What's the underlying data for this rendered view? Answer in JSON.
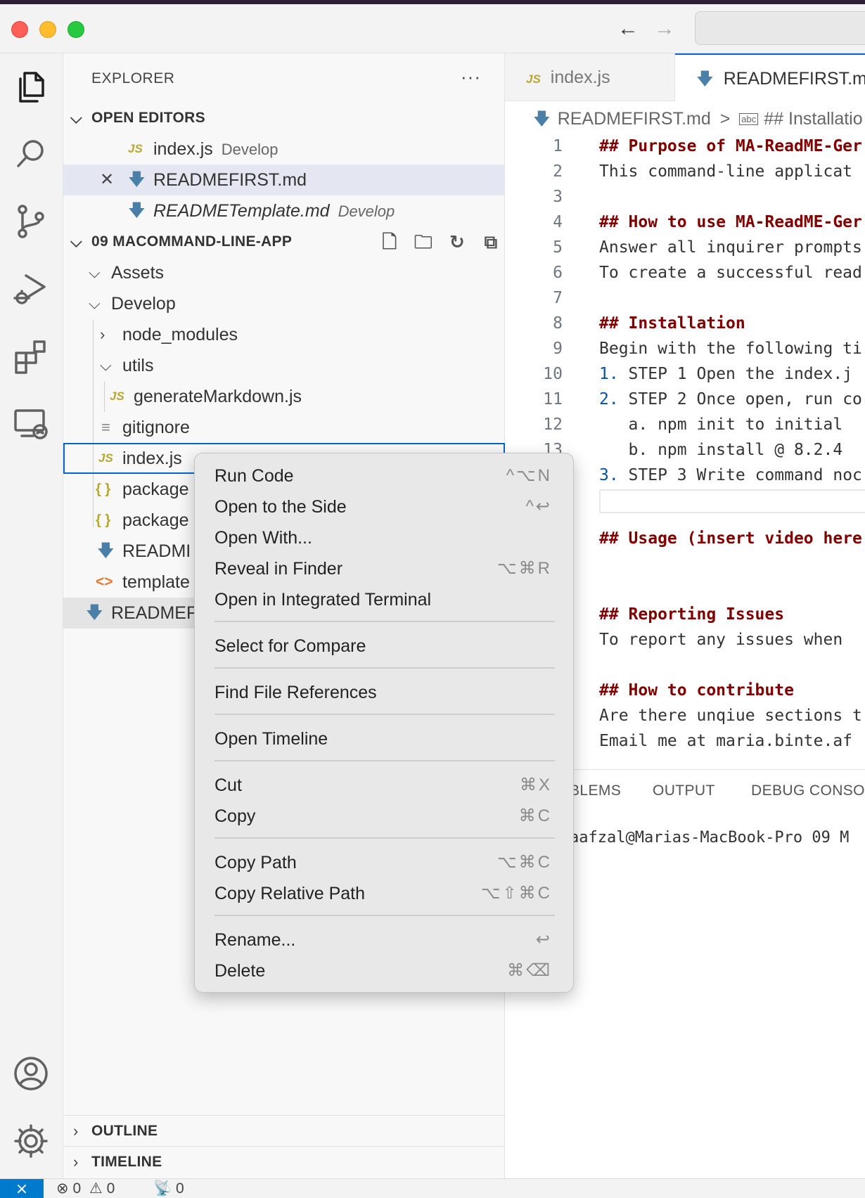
{
  "explorer": {
    "title": "EXPLORER",
    "more": "···",
    "open_editors": {
      "header": "OPEN EDITORS",
      "items": [
        {
          "name": "index.js",
          "desc": "Develop",
          "icon": "JS"
        },
        {
          "name": "READMEFIRST.md",
          "desc": "",
          "icon": "md"
        },
        {
          "name": "READMETemplate.md",
          "desc": "Develop",
          "icon": "md"
        }
      ]
    },
    "folder": {
      "header": "09 MACOMMAND-LINE-APP",
      "items": [
        {
          "name": "Assets"
        },
        {
          "name": "Develop"
        },
        {
          "name": "node_modules"
        },
        {
          "name": "utils"
        },
        {
          "name": "generateMarkdown.js",
          "icon": "JS"
        },
        {
          "name": "gitignore"
        },
        {
          "name": "index.js",
          "icon": "JS"
        },
        {
          "name": "package",
          "icon": "{ }"
        },
        {
          "name": "package",
          "icon": "{ }"
        },
        {
          "name": "READMI"
        },
        {
          "name": "template",
          "icon": "<>"
        },
        {
          "name": "READMEF"
        }
      ]
    },
    "outline": "OUTLINE",
    "timeline": "TIMELINE"
  },
  "editor": {
    "tabs": [
      {
        "label": "index.js",
        "icon": "JS"
      },
      {
        "label": "READMEFIRST.m"
      }
    ],
    "breadcrumb": {
      "file": "READMEFIRST.md",
      "sep": ">",
      "section_icon": "abc",
      "section": "## Installatio"
    },
    "lines": [
      {
        "n": "1",
        "text": "## Purpose of MA-ReadME-Ger",
        "type": "hdr"
      },
      {
        "n": "2",
        "text": "This command-line applicat",
        "type": "text"
      },
      {
        "n": "3",
        "text": "",
        "type": "text"
      },
      {
        "n": "4",
        "text": "## How to use MA-ReadME-Ger",
        "type": "hdr"
      },
      {
        "n": "5",
        "text": "Answer all inquirer prompts",
        "type": "text"
      },
      {
        "n": "6",
        "text": "To create a successful read",
        "type": "text"
      },
      {
        "n": "7",
        "text": "",
        "type": "text"
      },
      {
        "n": "8",
        "text": "## Installation",
        "type": "hdr"
      },
      {
        "n": "9",
        "text": "Begin with the following ti",
        "type": "text"
      },
      {
        "n": "10",
        "num": "1.",
        "text": " STEP 1 Open the index.j",
        "type": "text"
      },
      {
        "n": "11",
        "num": "2.",
        "text": " STEP 2 Once open, run co",
        "type": "text"
      },
      {
        "n": "12",
        "text": "   a. npm init to initial",
        "type": "text"
      },
      {
        "n": "13",
        "text": "   b. npm install @ 8.2.4",
        "type": "text"
      },
      {
        "n": "",
        "num": "3.",
        "text": " STEP 3 Write command noc",
        "type": "text"
      },
      {
        "n": "",
        "text": "",
        "type": "text"
      },
      {
        "n": "",
        "text": "## Usage (insert video here",
        "type": "hdr"
      },
      {
        "n": "",
        "text": "",
        "type": "text"
      },
      {
        "n": "",
        "text": "",
        "type": "text"
      },
      {
        "n": "",
        "text": "## Reporting Issues",
        "type": "hdr"
      },
      {
        "n": "",
        "text": "To report any issues when",
        "type": "text"
      },
      {
        "n": "",
        "text": "",
        "type": "text"
      },
      {
        "n": "",
        "text": "## How to contribute",
        "type": "hdr"
      },
      {
        "n": "",
        "text": "Are there unqiue sections t",
        "type": "text"
      },
      {
        "n": "",
        "text": "Email me at maria.binte.af",
        "type": "text"
      }
    ]
  },
  "panel": {
    "tabs": [
      "BLEMS",
      "OUTPUT",
      "DEBUG CONSO"
    ],
    "terminal_line": "aafzal@Marias-MacBook-Pro 09 M"
  },
  "context_menu": {
    "items": [
      {
        "label": "Run Code",
        "shortcut": "^⌥N"
      },
      {
        "label": "Open to the Side",
        "shortcut": "^↩"
      },
      {
        "label": "Open With...",
        "shortcut": ""
      },
      {
        "label": "Reveal in Finder",
        "shortcut": "⌥⌘R"
      },
      {
        "label": "Open in Integrated Terminal",
        "shortcut": ""
      },
      {
        "label": "Select for Compare",
        "shortcut": ""
      },
      {
        "label": "Find File References",
        "shortcut": ""
      },
      {
        "label": "Open Timeline",
        "shortcut": ""
      },
      {
        "label": "Cut",
        "shortcut": "⌘X"
      },
      {
        "label": "Copy",
        "shortcut": "⌘C"
      },
      {
        "label": "Copy Path",
        "shortcut": "⌥⌘C"
      },
      {
        "label": "Copy Relative Path",
        "shortcut": "⌥⇧⌘C"
      },
      {
        "label": "Rename...",
        "shortcut": "↩"
      },
      {
        "label": "Delete",
        "shortcut": "⌘⌫"
      }
    ]
  },
  "status": {
    "errors": "0",
    "warnings": "0",
    "ports": "0"
  },
  "colors": {
    "accent": "#0066cc",
    "markdown_header": "#800000",
    "js_icon": "#b8a732",
    "remote_indicator": "#007acc"
  }
}
